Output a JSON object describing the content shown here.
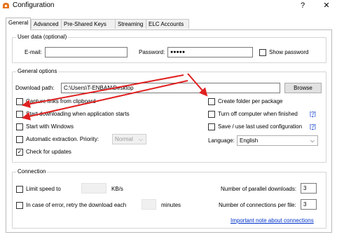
{
  "window": {
    "title": "Configuration",
    "help_glyph": "?",
    "close_glyph": "✕"
  },
  "tabs": [
    "General",
    "Advanced",
    "Pre-Shared Keys",
    "Streaming",
    "ELC Accounts"
  ],
  "user_data": {
    "group_label": "User data (optional)",
    "email_label": "E-mail:",
    "email_value": "",
    "password_label": "Password:",
    "password_value": "●●●●●",
    "show_password_label": "Show password",
    "show_password_checked": false
  },
  "general_options": {
    "group_label": "General options",
    "download_path_label": "Download path:",
    "download_path_value": "C:\\Users\\T-ENBAN\\Desktop",
    "browse_label": "Browse",
    "left_checks": [
      {
        "label": "Capture links from clipboard",
        "checked": false
      },
      {
        "label": "Start downloading when application starts",
        "checked": false
      },
      {
        "label": "Start with Windows",
        "checked": false
      },
      {
        "label": "Automatic extraction. Priority:",
        "checked": false
      },
      {
        "label": "Check for updates",
        "checked": true
      }
    ],
    "priority_value": "Normal",
    "right_checks": [
      {
        "label": "Create folder per package",
        "checked": false
      },
      {
        "label": "Turn off computer when finished",
        "checked": false,
        "help": "[?]"
      },
      {
        "label": "Save / use last used configuration",
        "checked": false,
        "help": "[?]"
      }
    ],
    "language_label": "Language:",
    "language_value": "English",
    "check_glyph": "✓"
  },
  "connection": {
    "group_label": "Connection",
    "limit_speed_label": "Limit speed to",
    "limit_speed_value": "",
    "speed_unit": "KB/s",
    "retry_label": "In case of error, retry the download each",
    "retry_value": "",
    "retry_unit": "minutes",
    "parallel_label": "Number of parallel downloads:",
    "parallel_value": "3",
    "per_file_label": "Number of connections per file:",
    "per_file_value": "3",
    "note_link": "Important note about connections"
  },
  "colors": {
    "annotation_arrow": "#e02020",
    "link": "#0033cc",
    "app_icon": "#e8731a"
  },
  "icons": {
    "app": "app-logo-icon",
    "caret": "chevron-down-icon"
  }
}
